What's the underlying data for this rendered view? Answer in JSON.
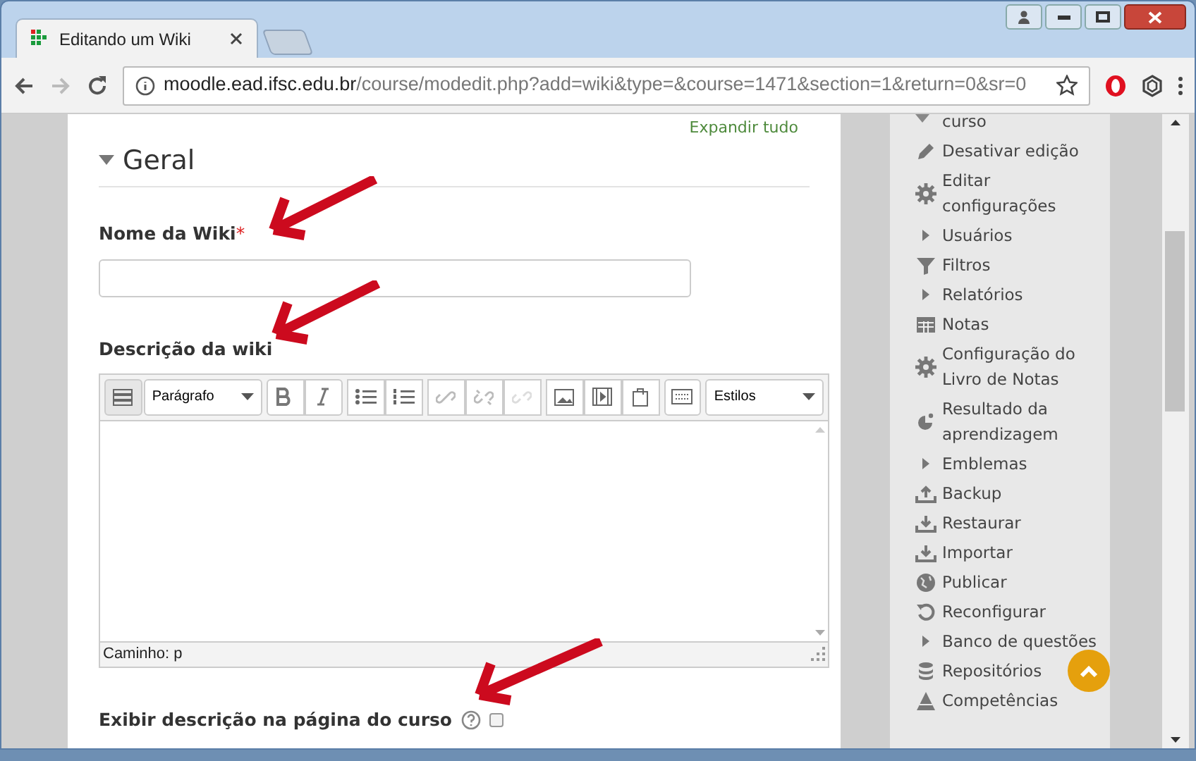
{
  "browser": {
    "tab_title": "Editando um Wiki",
    "url_host": "moodle.ead.ifsc.edu.br",
    "url_path": "/course/modedit.php?add=wiki&type=&course=1471&section=1&return=0&sr=0"
  },
  "form": {
    "expand_all": "Expandir tudo",
    "section_title": "Geral",
    "section_expanded": true,
    "name_label": "Nome da Wiki",
    "required_mark": "*",
    "description_label": "Descrição da wiki",
    "editor": {
      "format": "Parágrafo",
      "styles": "Estilos",
      "path": "Caminho: p"
    },
    "show_description_label": "Exibir descrição na página do curso",
    "show_description_checked": false
  },
  "sidebar": {
    "items": [
      {
        "kind": "node",
        "label": "curso",
        "expanded": true
      },
      {
        "kind": "link",
        "label": "Desativar edição"
      },
      {
        "kind": "link",
        "label": "Editar configurações"
      },
      {
        "kind": "node",
        "label": "Usuários",
        "expanded": false
      },
      {
        "kind": "link",
        "label": "Filtros"
      },
      {
        "kind": "node",
        "label": "Relatórios",
        "expanded": false
      },
      {
        "kind": "link",
        "label": "Notas"
      },
      {
        "kind": "link",
        "label": "Configuração do Livro de Notas"
      },
      {
        "kind": "link",
        "label": "Resultado da aprendizagem"
      },
      {
        "kind": "node",
        "label": "Emblemas",
        "expanded": false
      },
      {
        "kind": "link",
        "label": "Backup"
      },
      {
        "kind": "link",
        "label": "Restaurar"
      },
      {
        "kind": "link",
        "label": "Importar"
      },
      {
        "kind": "link",
        "label": "Publicar"
      },
      {
        "kind": "link",
        "label": "Reconfigurar"
      },
      {
        "kind": "node",
        "label": "Banco de questões",
        "expanded": false
      },
      {
        "kind": "link",
        "label": "Repositórios"
      },
      {
        "kind": "link",
        "label": "Competências"
      }
    ]
  }
}
